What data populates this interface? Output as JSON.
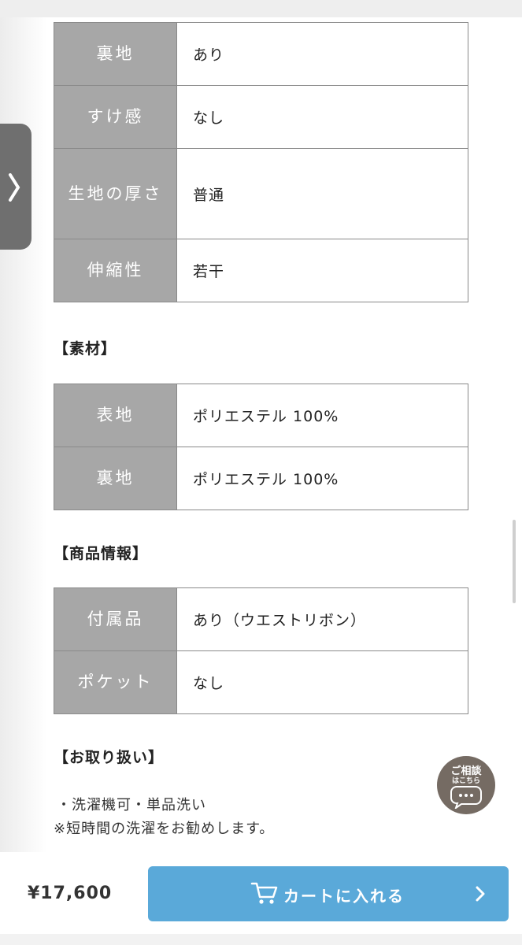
{
  "tables": {
    "detail": [
      {
        "label": "裏地",
        "value": "あり"
      },
      {
        "label": "すけ感",
        "value": "なし"
      },
      {
        "label": "生地の厚さ",
        "value": "普通"
      },
      {
        "label": "伸縮性",
        "value": "若干"
      }
    ],
    "material": [
      {
        "label": "表地",
        "value": "ポリエステル 100%"
      },
      {
        "label": "裏地",
        "value": "ポリエステル 100%"
      }
    ],
    "product_info": [
      {
        "label": "付属品",
        "value": "あり（ウエストリボン）"
      },
      {
        "label": "ポケット",
        "value": "なし"
      }
    ]
  },
  "sections": {
    "material_title": "【素材】",
    "product_info_title": "【商品情報】",
    "care_title": "【お取り扱い】"
  },
  "care_notes": {
    "line1": "・洗濯機可・単品洗い",
    "line2": "※短時間の洗濯をお勧めします。"
  },
  "chat": {
    "line1": "ご相談",
    "line2": "はこちら",
    "icon": "speech-bubble-icon"
  },
  "purchase": {
    "price": "¥17,600",
    "cart_label": "カートに入れる",
    "cart_icon": "cart-icon"
  },
  "colors": {
    "header_cell": "#a7a7a7",
    "cart_button": "#5aa9d9",
    "chat_bubble": "#756b63",
    "side_tab": "#6f6f6f"
  }
}
